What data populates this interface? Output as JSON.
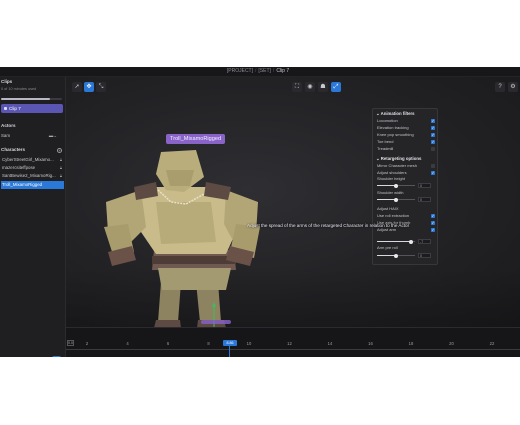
{
  "breadcrumb": {
    "part1": "[PROJECT]",
    "part2": "[SET]",
    "current": "Clip 7"
  },
  "sidebar": {
    "clips_heading": "Clips",
    "clips_usage": "0 of 10 minutes used",
    "usage_fraction": 0.8,
    "clip_label": "Clip 7",
    "actors_heading": "Actors",
    "actor_name": "Sam",
    "characters_heading": "Characters",
    "characters": [
      {
        "name": "CyberStreetGirl_Mixamo..."
      },
      {
        "name": "mazercsiteffpose"
      },
      {
        "name": "SantBewise2_MixamoRig..."
      },
      {
        "name": "Troll_MixamoRigged"
      }
    ],
    "bottom_number": "7"
  },
  "viewport": {
    "character_label": "Troll_MixamoRigged",
    "tooltip": "Adjust the spread of the arms of the retargeted Character in relation to the Actor"
  },
  "panel": {
    "animation_filters_heading": "Animation filters",
    "filters": [
      {
        "label": "Locomotion",
        "checked": true
      },
      {
        "label": "Elevation tracking",
        "checked": true
      },
      {
        "label": "Knee pop smoothing",
        "checked": true
      },
      {
        "label": "Toe bend",
        "checked": true
      },
      {
        "label": "Treadmill",
        "checked": false
      }
    ],
    "retargeting_heading": "Retargeting options",
    "mirror_label": "Mirror Character mesh",
    "adjust_shoulders_label": "Adjust shoulders",
    "shoulder_height_label": "Shoulder height",
    "shoulder_height_value": "0",
    "shoulder_height_level": 0.5,
    "shoulder_width_label": "Shoulder width",
    "shoulder_width_value": "0",
    "shoulder_width_level": 0.5,
    "adjust_hands_label": "Adjust HAIX",
    "use_roll_label": "Use roll extraction",
    "use_axis_label": "Use axis for thumb",
    "adjust_arm_label": "Adjust arm",
    "arm_spread_value": "-7",
    "arm_spread_level": 0.9,
    "arm_pre_roll_label": "Arm pre roll",
    "arm_pre_roll_value": "0",
    "arm_pre_roll_level": 0.5
  },
  "timeline": {
    "start_value": "0.0",
    "ticks": [
      "2",
      "4",
      "6",
      "8",
      "10",
      "12",
      "14",
      "16",
      "18",
      "20",
      "22"
    ],
    "playhead_value": "8.86"
  },
  "colors": {
    "accent": "#2a79d9",
    "label_purple": "#8a63c9",
    "clip_purple": "#5b56b3"
  }
}
